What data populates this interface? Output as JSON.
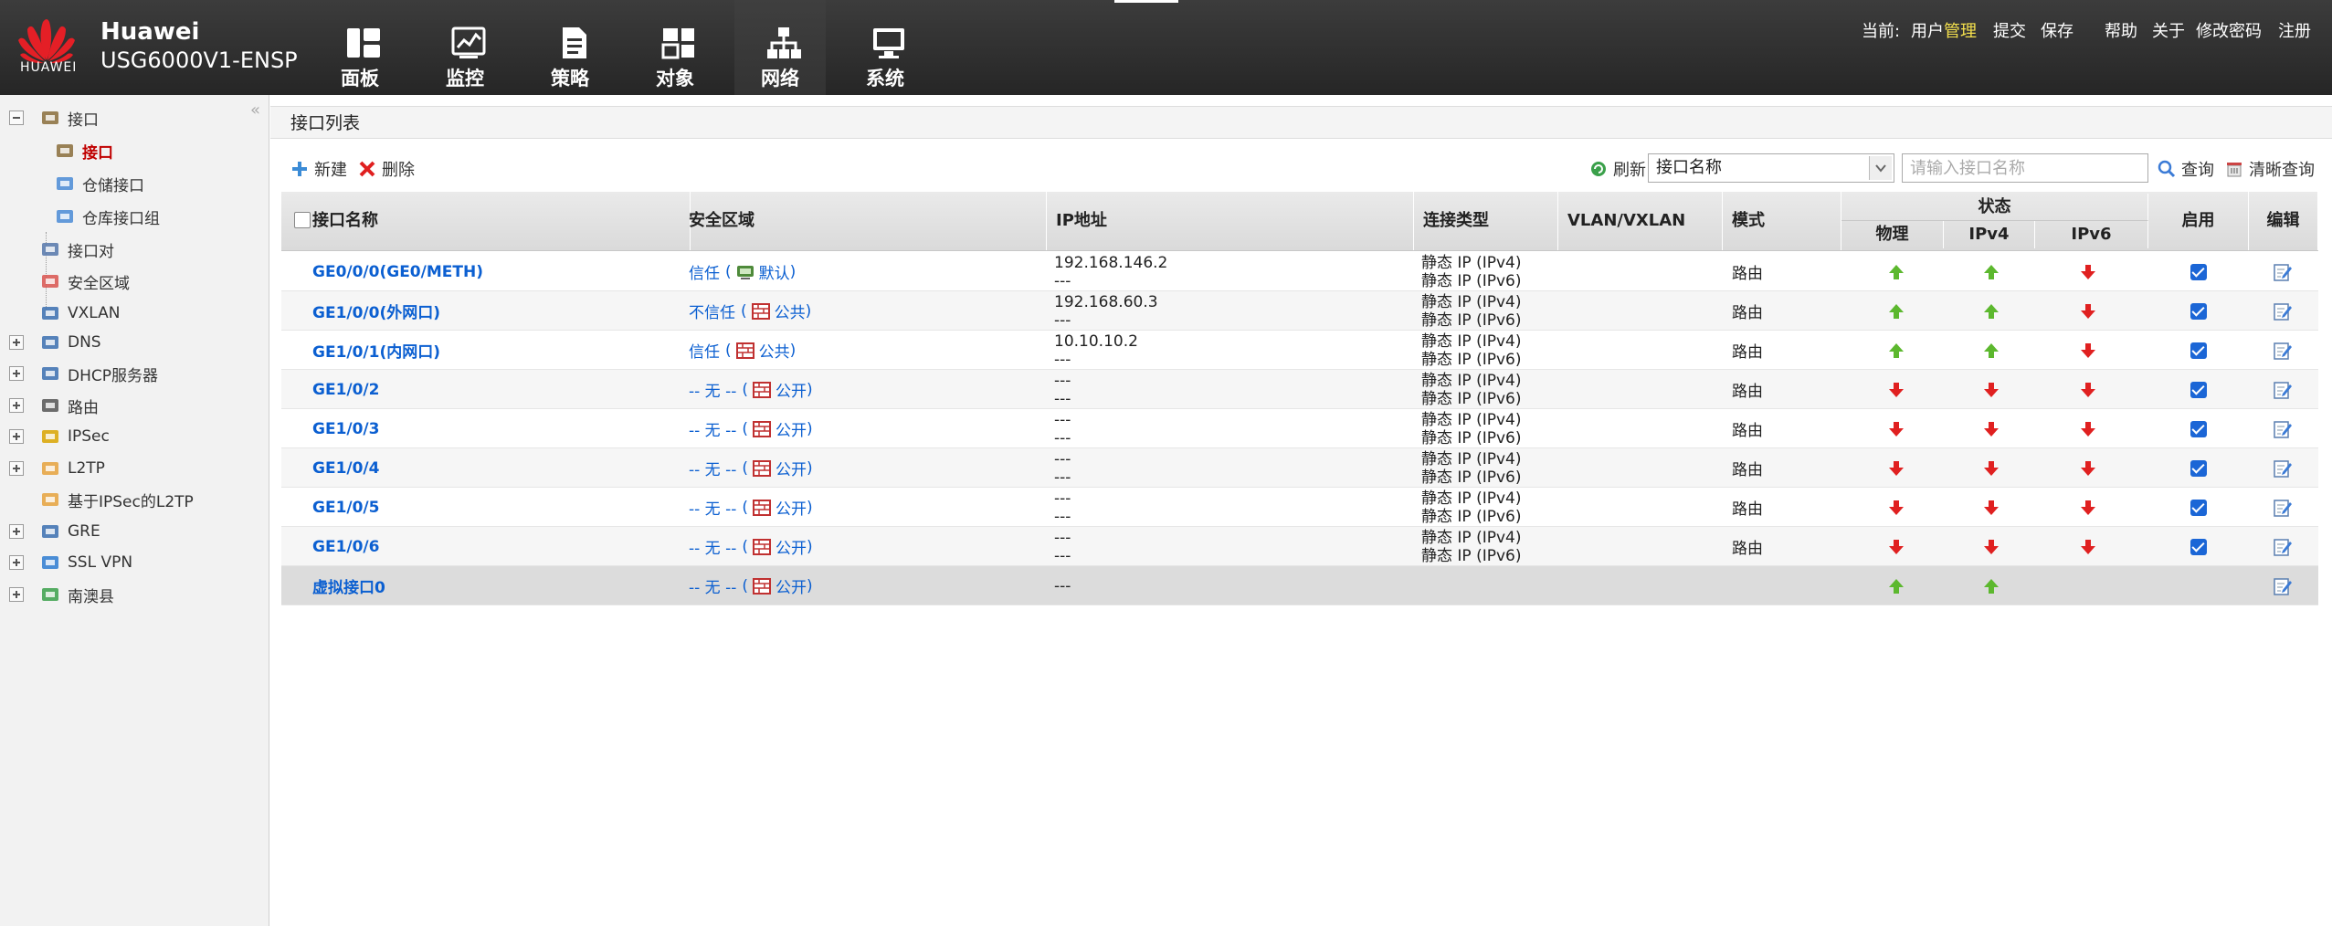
{
  "header": {
    "brand": "Huawei",
    "model": "USG6000V1-ENSP",
    "logo_text": "HUAWEI",
    "nav": [
      {
        "label": "面板",
        "icon": "dashboard-icon"
      },
      {
        "label": "监控",
        "icon": "monitor-icon"
      },
      {
        "label": "策略",
        "icon": "policy-icon"
      },
      {
        "label": "对象",
        "icon": "object-icon"
      },
      {
        "label": "网络",
        "icon": "network-icon",
        "active": true
      },
      {
        "label": "系统",
        "icon": "system-icon"
      }
    ],
    "current_label": "当前:",
    "user": "用户",
    "role": "管理",
    "links": [
      "提交",
      "保存",
      "帮助",
      "关于",
      "修改密码",
      "注册"
    ]
  },
  "sidebar": {
    "items": [
      {
        "label": "接口",
        "icon": "interface-icon",
        "expander": "minus"
      },
      {
        "label": "接口",
        "icon": "interface-icon",
        "selected": true
      },
      {
        "label": "仓储接口",
        "icon": "storage-interface-icon"
      },
      {
        "label": "仓库接口组",
        "icon": "storage-group-icon"
      },
      {
        "label": "接口对",
        "icon": "interface-pair-icon"
      },
      {
        "label": "安全区域",
        "icon": "security-zone-icon"
      },
      {
        "label": "VXLAN",
        "icon": "vxlan-icon"
      },
      {
        "label": "DNS",
        "icon": "dns-icon",
        "expander": "plus"
      },
      {
        "label": "DHCP服务器",
        "icon": "dhcp-icon",
        "expander": "plus"
      },
      {
        "label": "路由",
        "icon": "route-icon",
        "expander": "plus"
      },
      {
        "label": "IPSec",
        "icon": "ipsec-icon",
        "expander": "plus"
      },
      {
        "label": "L2TP",
        "icon": "l2tp-icon",
        "expander": "plus"
      },
      {
        "label": "基于IPSec的L2TP",
        "icon": "l2tp-ipsec-icon"
      },
      {
        "label": "GRE",
        "icon": "gre-icon",
        "expander": "plus"
      },
      {
        "label": "SSL VPN",
        "icon": "ssl-vpn-icon",
        "expander": "plus"
      },
      {
        "label": "南澳县",
        "icon": "shield-icon",
        "expander": "plus"
      }
    ]
  },
  "main": {
    "title": "接口列表",
    "toolbar": {
      "add": "新建",
      "delete": "删除",
      "refresh": "刷新",
      "select_value": "接口名称",
      "search_placeholder": "请输入接口名称",
      "query": "查询",
      "clear": "清晰查询"
    },
    "columns": {
      "name": "接口名称",
      "zone": "安全区域",
      "ip": "IP地址",
      "conn": "连接类型",
      "vlan": "VLAN/VXLAN",
      "mode": "模式",
      "status": "状态",
      "phys": "物理",
      "ipv4": "IPv4",
      "ipv6": "IPv6",
      "enable": "启用",
      "edit": "编辑"
    },
    "rows": [
      {
        "name": "GE0/0/0(GE0/METH)",
        "zone": "信任",
        "vs": "默认",
        "ip1": "192.168.146.2",
        "ip2": "---",
        "c1": "静态 IP (IPv4)",
        "c2": "静态 IP (IPv6)",
        "mode": "路由",
        "phys": "up",
        "v4": "up",
        "v6": "down",
        "enabled": true
      },
      {
        "name": "GE1/0/0(外网口)",
        "zone": "不信任",
        "vs": "公共",
        "ip1": "192.168.60.3",
        "ip2": "---",
        "c1": "静态 IP (IPv4)",
        "c2": "静态 IP (IPv6)",
        "mode": "路由",
        "phys": "up",
        "v4": "up",
        "v6": "down",
        "enabled": true
      },
      {
        "name": "GE1/0/1(内网口)",
        "zone": "信任",
        "vs": "公共",
        "ip1": "10.10.10.2",
        "ip2": "---",
        "c1": "静态 IP (IPv4)",
        "c2": "静态 IP (IPv6)",
        "mode": "路由",
        "phys": "up",
        "v4": "up",
        "v6": "down",
        "enabled": true
      },
      {
        "name": "GE1/0/2",
        "zone": "-- 无 --",
        "vs": "公开",
        "ip1": "---",
        "ip2": "---",
        "c1": "静态 IP (IPv4)",
        "c2": "静态 IP (IPv6)",
        "mode": "路由",
        "phys": "down",
        "v4": "down",
        "v6": "down",
        "enabled": true
      },
      {
        "name": "GE1/0/3",
        "zone": "-- 无 --",
        "vs": "公开",
        "ip1": "---",
        "ip2": "---",
        "c1": "静态 IP (IPv4)",
        "c2": "静态 IP (IPv6)",
        "mode": "路由",
        "phys": "down",
        "v4": "down",
        "v6": "down",
        "enabled": true
      },
      {
        "name": "GE1/0/4",
        "zone": "-- 无 --",
        "vs": "公开",
        "ip1": "---",
        "ip2": "---",
        "c1": "静态 IP (IPv4)",
        "c2": "静态 IP (IPv6)",
        "mode": "路由",
        "phys": "down",
        "v4": "down",
        "v6": "down",
        "enabled": true
      },
      {
        "name": "GE1/0/5",
        "zone": "-- 无 --",
        "vs": "公开",
        "ip1": "---",
        "ip2": "---",
        "c1": "静态 IP (IPv4)",
        "c2": "静态 IP (IPv6)",
        "mode": "路由",
        "phys": "down",
        "v4": "down",
        "v6": "down",
        "enabled": true
      },
      {
        "name": "GE1/0/6",
        "zone": "-- 无 --",
        "vs": "公开",
        "ip1": "---",
        "ip2": "---",
        "c1": "静态 IP (IPv4)",
        "c2": "静态 IP (IPv6)",
        "mode": "路由",
        "phys": "down",
        "v4": "down",
        "v6": "down",
        "enabled": true
      },
      {
        "name": "虚拟接口0",
        "zone": "-- 无 --",
        "vs": "公开",
        "ip1": "---",
        "ip2": "",
        "c1": "",
        "c2": "",
        "mode": "",
        "phys": "up",
        "v4": "up",
        "v6": "",
        "enabled": false
      }
    ]
  },
  "colors": {
    "up": "#5cb82e",
    "down": "#e02020",
    "link": "#0b5fd1",
    "selected": "#c00000",
    "role": "#f4e04d"
  }
}
